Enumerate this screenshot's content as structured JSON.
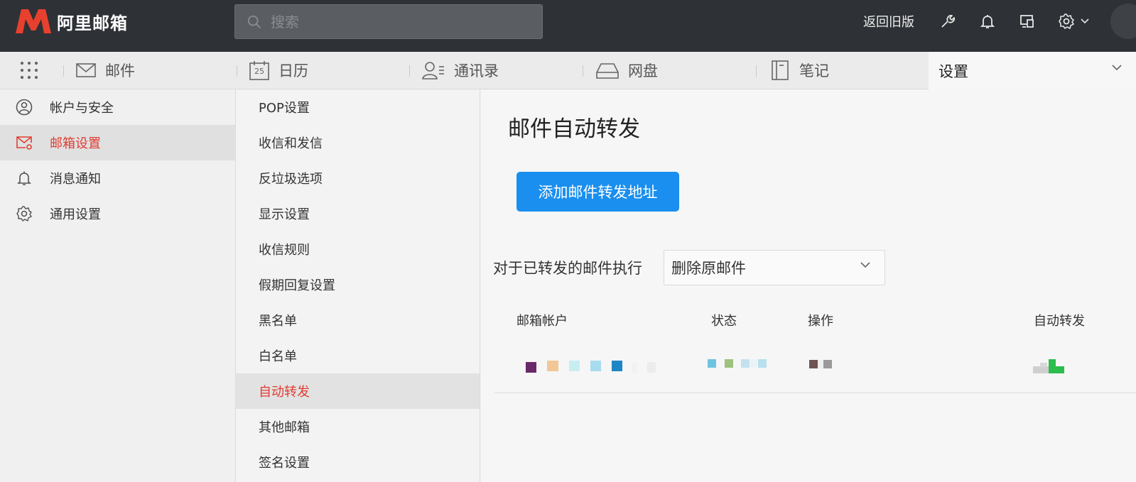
{
  "topbar": {
    "brand": "阿里邮箱",
    "search_placeholder": "搜索",
    "old_version_label": "返回旧版",
    "icons": [
      "wrench-icon",
      "bell-icon",
      "devices-icon",
      "gear-icon",
      "chevron-down-icon"
    ]
  },
  "nav": {
    "tabs": [
      {
        "label": "邮件",
        "icon": "envelope-icon"
      },
      {
        "label": "日历",
        "icon": "calendar-icon",
        "calendar_day": "25"
      },
      {
        "label": "通讯录",
        "icon": "contacts-icon"
      },
      {
        "label": "网盘",
        "icon": "drive-icon"
      },
      {
        "label": "笔记",
        "icon": "notebook-icon"
      }
    ],
    "active_label": "设置"
  },
  "sidebar": {
    "items": [
      {
        "label": "帐户与安全",
        "icon": "user-circle-icon"
      },
      {
        "label": "邮箱设置",
        "icon": "mail-settings-icon"
      },
      {
        "label": "消息通知",
        "icon": "bell-icon"
      },
      {
        "label": "通用设置",
        "icon": "gear-icon"
      }
    ],
    "active_index": 1
  },
  "submenu": {
    "items": [
      "POP设置",
      "收信和发信",
      "反垃圾选项",
      "显示设置",
      "收信规则",
      "假期回复设置",
      "黑名单",
      "白名单",
      "自动转发",
      "其他邮箱",
      "签名设置"
    ],
    "active_index": 8
  },
  "main": {
    "title": "邮件自动转发",
    "add_button": "添加邮件转发地址",
    "action_label": "对于已转发的邮件执行",
    "action_select_value": "删除原邮件",
    "table_headers": {
      "account": "邮箱帐户",
      "status": "状态",
      "operation": "操作",
      "auto_forward": "自动转发"
    }
  },
  "colors": {
    "topbar": "#2e3135",
    "accent_red": "#e03c31",
    "button_blue": "#1a8fef"
  }
}
